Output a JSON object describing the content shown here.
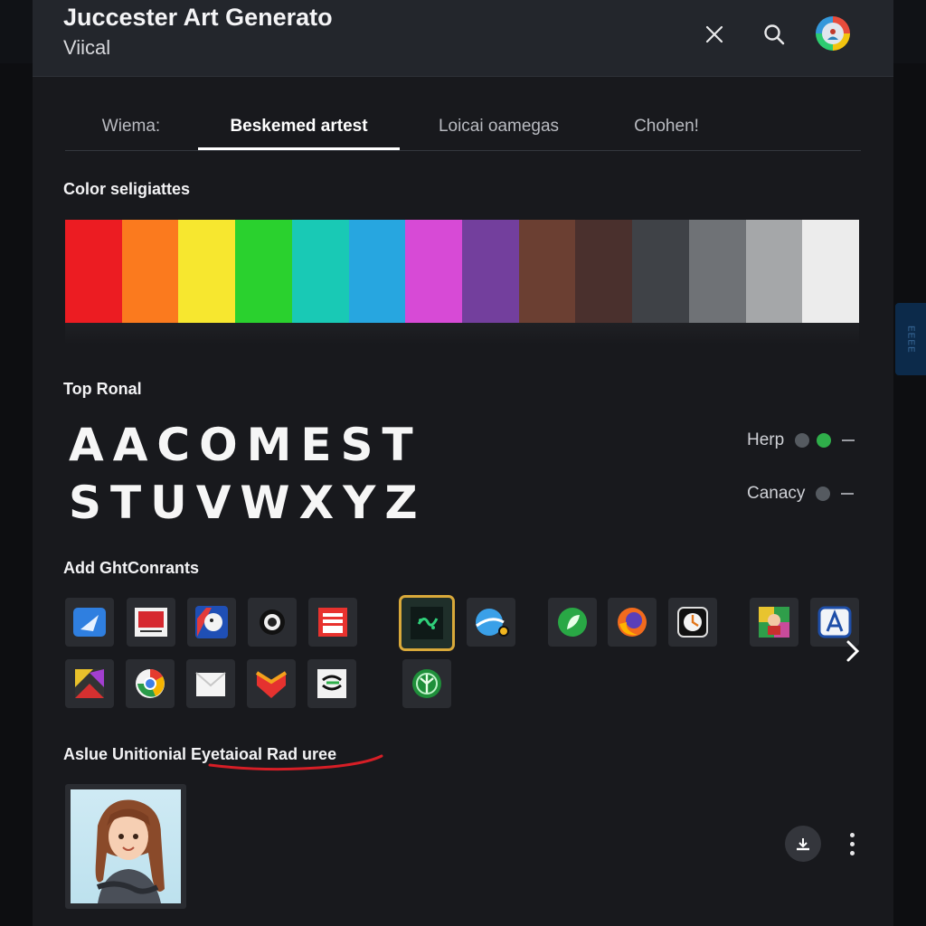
{
  "header": {
    "title": "Juccester Art Generato",
    "subtitle": "Viical"
  },
  "side_tab": {
    "label": "ЕЕЕЕ"
  },
  "tabs": [
    {
      "label": "Wiema:"
    },
    {
      "label": "Beskemed artest"
    },
    {
      "label": "Loicai oamegas"
    },
    {
      "label": "Chohen!"
    }
  ],
  "active_tab": "Beskemed artest",
  "palette": {
    "title": "Color seligiattes",
    "colors": [
      "#ec1c22",
      "#fb7a1e",
      "#f7e72f",
      "#2ad12e",
      "#19c9b5",
      "#27a6e0",
      "#d74ad6",
      "#733f9d",
      "#6b3f32",
      "#4a302d",
      "#3f4247",
      "#6f7276",
      "#a5a7a9",
      "#ececec"
    ]
  },
  "fonts": {
    "title": "Top Ronal",
    "preview_line1": "AACOMEST",
    "preview_line2": "STUVWXYZ",
    "options": [
      {
        "label": "Herp",
        "dot_colors": [
          "#555a60",
          "#2fae4a"
        ]
      },
      {
        "label": "Canacy",
        "dot_colors": [
          "#555a60"
        ]
      }
    ]
  },
  "apps": {
    "title": "Add GhtConrants",
    "icons": [
      "paper-plane-icon",
      "image-frame-icon",
      "face-logo-icon",
      "camera-lens-icon",
      "document-stack-icon",
      "circuit-chip-icon",
      "globe-swoosh-icon",
      "green-leaf-icon",
      "firefox-icon",
      "clock-badge-icon",
      "character-portrait-icon",
      "app-store-icon",
      "photo-collage-icon",
      "chrome-icon",
      "envelope-icon",
      "chevron-shield-icon",
      "spark-logo-icon",
      "green-tree-icon"
    ],
    "selected_icon": "circuit-chip-icon"
  },
  "result": {
    "title": "Aslue Unitionial Eyetaioal Rad uree",
    "underline_color": "#d61e26"
  }
}
